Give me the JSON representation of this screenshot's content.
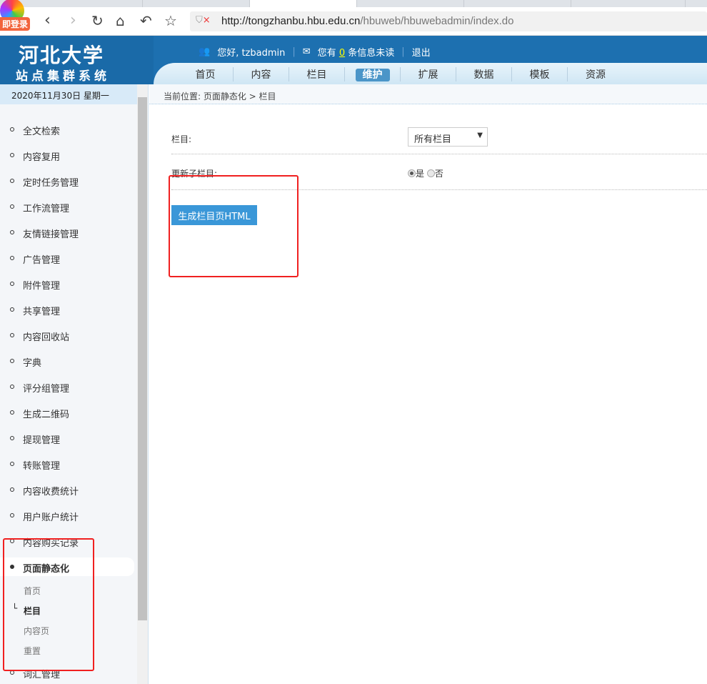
{
  "browser": {
    "login_label": "即登录",
    "url_host": "http://tongzhanbu.hbu.edu.cn",
    "url_path": "/hbuweb/hbuwebadmin/index.do"
  },
  "header": {
    "brand_line1": "河北大学",
    "brand_line2": "站点集群系统",
    "greeting": "您好, tzbadmin",
    "msg_prefix": "您有",
    "msg_count": "0",
    "msg_suffix": "条信息未读",
    "logout": "退出",
    "nav": [
      "首页",
      "内容",
      "栏目",
      "维护",
      "扩展",
      "数据",
      "模板",
      "资源"
    ],
    "active_nav": "维护"
  },
  "sidebar": {
    "date": "2020年11月30日 星期一",
    "items": [
      "全文检索",
      "内容复用",
      "定时任务管理",
      "工作流管理",
      "友情链接管理",
      "广告管理",
      "附件管理",
      "共享管理",
      "内容回收站",
      "字典",
      "评分组管理",
      "生成二维码",
      "提现管理",
      "转账管理",
      "内容收费统计",
      "用户账户统计",
      "内容购买记录"
    ],
    "active": "页面静态化",
    "subitems": [
      "首页",
      "栏目",
      "内容页",
      "重置"
    ],
    "after": "词汇管理"
  },
  "main": {
    "breadcrumb": "当前位置: 页面静态化 > 栏目",
    "channel_label": "栏目:",
    "channel_value": "所有栏目",
    "update_label": "更新子栏目:",
    "yes": "是",
    "no": "否",
    "generate_button": "生成栏目页HTML"
  },
  "colors": {
    "header": "#1d70b0",
    "button": "#3a97d8",
    "annotation": "#f02020"
  }
}
